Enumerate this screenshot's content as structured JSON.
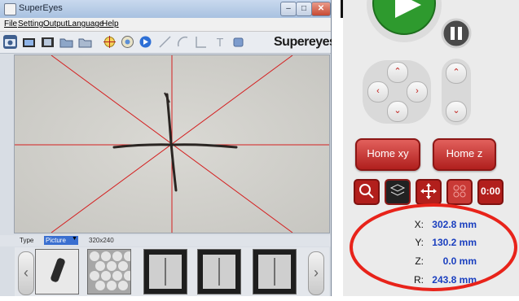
{
  "window": {
    "title": "SuperEyes",
    "controls": [
      "–",
      "□",
      "✕"
    ]
  },
  "menu": [
    "File",
    "Setting",
    "Output",
    "Language",
    "Help"
  ],
  "toolbar": {
    "icons": [
      "camera-icon",
      "video-icon",
      "film-icon",
      "folder-photo-icon",
      "folder-video-icon",
      "crosshair-icon",
      "settings-wheel-icon",
      "circle-arrow-icon",
      "line-tool-icon",
      "arc-tool-icon",
      "angle-tool-icon",
      "text-tool-icon",
      "eraser-icon"
    ],
    "brand": "Supereyes"
  },
  "strip": {
    "type_label": "Type",
    "type_value": "Picture",
    "resolution": "320x240"
  },
  "thumbnails": [
    "thumb-1",
    "thumb-2",
    "thumb-3",
    "thumb-4",
    "thumb-5"
  ],
  "panel": {
    "home_xy": "Home xy",
    "home_z": "Home z",
    "tools": [
      "magnify-icon",
      "layers-icon",
      "move-icon",
      "grid-icon",
      "timer-icon"
    ],
    "timer_text": "0:00",
    "coords": [
      {
        "key": "X:",
        "value": "302.8 mm"
      },
      {
        "key": "Y:",
        "value": "130.2 mm"
      },
      {
        "key": "Z:",
        "value": "0.0 mm"
      },
      {
        "key": "R:",
        "value": "243.8 mm"
      }
    ]
  },
  "colors": {
    "accent_red": "#b21f1c",
    "coord_blue": "#1a3fbf",
    "annotation_red": "#e8231a",
    "play_green": "#2e9a2e"
  }
}
